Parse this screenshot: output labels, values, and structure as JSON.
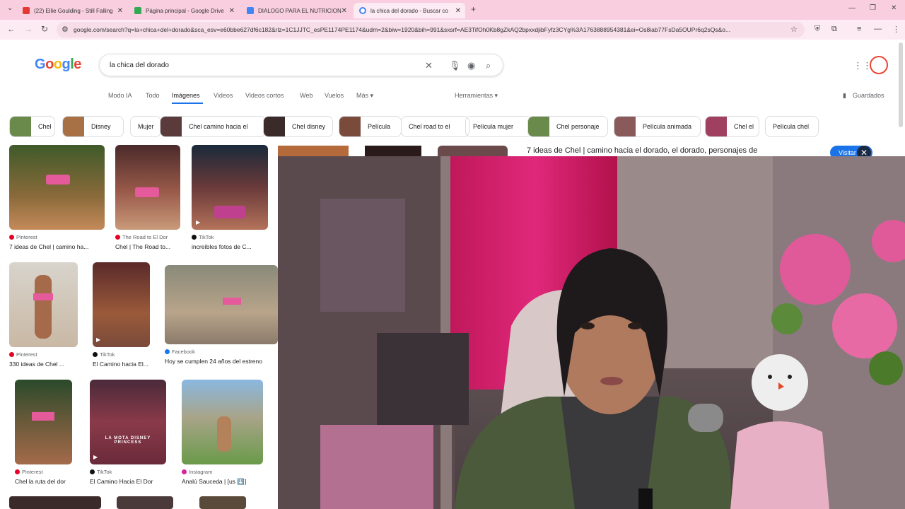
{
  "browser": {
    "tabs": [
      {
        "title": "(22) Ellie Goulding - Still Falling",
        "favicon_color": "#e53935"
      },
      {
        "title": "Página principal - Google Drive",
        "favicon_color": "#34a853"
      },
      {
        "title": "DIALOGO PARA EL NUTRICION",
        "favicon_color": "#4285f4"
      },
      {
        "title": "la chica del dorado - Buscar co",
        "favicon_color": "#4285f4"
      }
    ],
    "new_tab_label": "+",
    "url": "google.com/search?q=la+chica+del+dorado&sca_esv=e60bbe627df6c182&rlz=1C1JJTC_esPE1174PE1174&udm=2&biw=1920&bih=991&sxsrf=AE3TifOh0Kb8gZkAQ2bpxxdjibFyfz3CYg%3A1763888954381&ei=Os8iab77FsDa5OUPr6q2sQs&o..."
  },
  "search": {
    "logo": "Google",
    "query": "la chica del dorado",
    "clear_icon": "close-icon",
    "mic_icon": "mic-icon",
    "lens_icon": "lens-icon",
    "search_icon": "search-icon"
  },
  "nav_tabs": [
    "Modo IA",
    "Todo",
    "Imágenes",
    "Videos",
    "Videos cortos",
    "Web",
    "Vuelos",
    "Más ▾"
  ],
  "tools_label": "Herramientas ▾",
  "saved_label": "Guardados",
  "chips": [
    {
      "label": "Chel",
      "thumb": true
    },
    {
      "label": "Disney",
      "thumb": true
    },
    {
      "label": "Mujer",
      "thumb": false
    },
    {
      "label": "Chel camino hacia el",
      "thumb": true
    },
    {
      "label": "Chel disney",
      "thumb": true
    },
    {
      "label": "Película",
      "thumb": true
    },
    {
      "label": "Chel road to el",
      "thumb": false
    },
    {
      "label": "Película mujer",
      "thumb": false
    },
    {
      "label": "Chel personaje",
      "thumb": true
    },
    {
      "label": "Película animada",
      "thumb": true
    },
    {
      "label": "Chel el",
      "thumb": true
    },
    {
      "label": "Película chel",
      "thumb": false
    }
  ],
  "results": [
    {
      "source": "Pinterest",
      "title": "7 ideas de Chel | camino ha...",
      "src_color": "#e60023"
    },
    {
      "source": "The Road to El Dor",
      "title": "Chel | The Road to...",
      "src_color": "#e60023"
    },
    {
      "source": "TikTok",
      "title": "increíbles fotos de C...",
      "src_color": "#111111"
    },
    {
      "source": "Pinterest",
      "title": "330 ideas de Chel ...",
      "src_color": "#e60023"
    },
    {
      "source": "TikTok",
      "title": "El Camino hacia El...",
      "src_color": "#111111"
    },
    {
      "source": "Facebook",
      "title": "Hoy se cumplen 24 años del estreno",
      "src_color": "#1877f2"
    },
    {
      "source": "Pinterest",
      "title": "Chel la ruta del dor",
      "src_color": "#e60023"
    },
    {
      "source": "TikTok",
      "title": "El Camino Hacia El Dor",
      "src_color": "#111111"
    },
    {
      "source": "Instagram",
      "title": "Analú Sauceda | [us ⬇️]",
      "src_color": "#d6249f"
    }
  ],
  "thumb_text": "LA MOTA DISNEY PRINCESS",
  "preview_panel": {
    "title": "7 ideas de Chel | camino hacia el dorado, el dorado, personajes de",
    "visit_label": "Visitar",
    "close_icon": "close-icon"
  }
}
